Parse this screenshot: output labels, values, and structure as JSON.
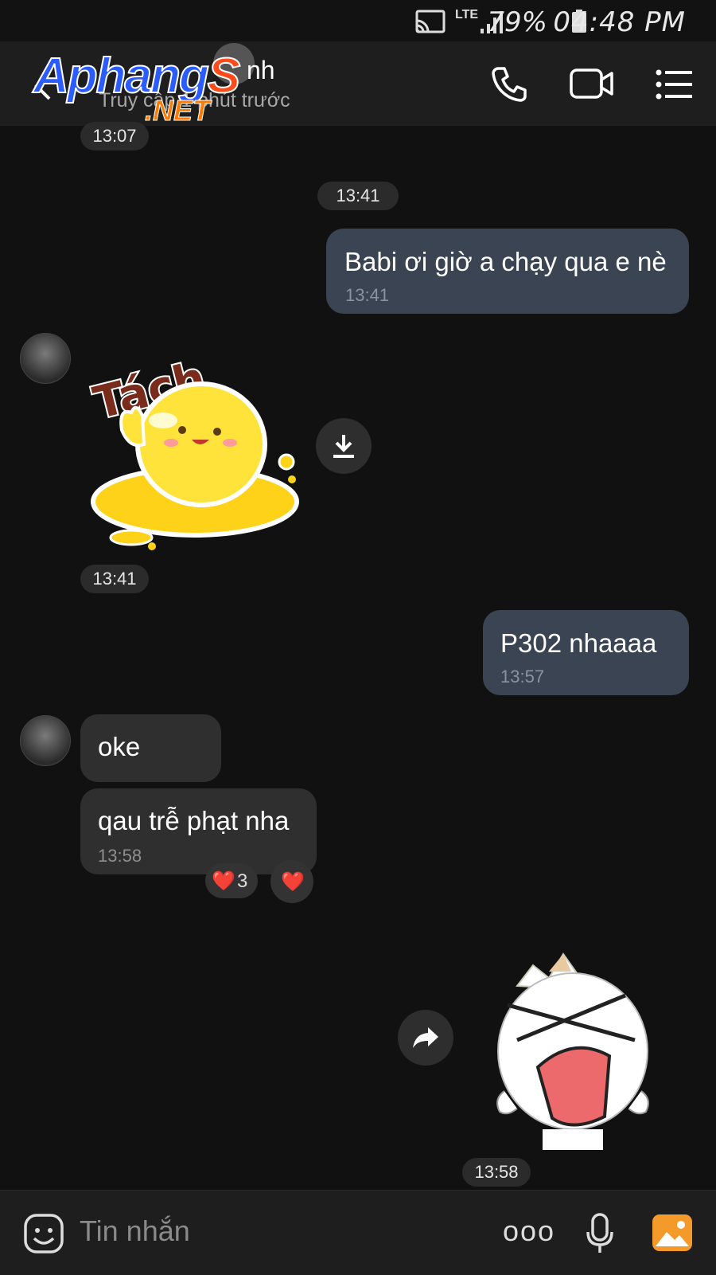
{
  "status_bar": {
    "network": "LTE",
    "battery": "79%",
    "time": "04:48 PM",
    "icons": [
      "cast-icon",
      "signal-icon",
      "battery-icon"
    ]
  },
  "header": {
    "contact_name": "nh",
    "status": "Truy cập 1 phút trước",
    "watermark_main": "Aphang",
    "watermark_s": "S",
    "watermark_net": ".NET",
    "icons": [
      "back-icon",
      "phone-icon",
      "video-icon",
      "menu-icon"
    ]
  },
  "messages": {
    "top_time": "13:07",
    "chip_1341": "13:41",
    "out_1": {
      "text": "Babi ơi giờ a chạy qua e nè",
      "time": "13:41"
    },
    "sticker_in": {
      "label": "Tách",
      "time": "13:41"
    },
    "out_2": {
      "text": "P302 nhaaaa",
      "time": "13:57"
    },
    "in_1": {
      "text": "oke"
    },
    "in_2": {
      "text": "qau trễ phạt nha",
      "time": "13:58"
    },
    "reaction": {
      "emoji": "❤️",
      "count": "3",
      "react_button": "❤️"
    },
    "sticker_out": {
      "time": "13:58"
    }
  },
  "composer": {
    "placeholder": "Tin nhắn",
    "more_label": "ooo",
    "icons": [
      "emoji-icon",
      "more-icon",
      "mic-icon",
      "gallery-icon"
    ]
  },
  "colors": {
    "background": "#111111",
    "outgoing_bubble": "#3a4452",
    "incoming_bubble": "#2f2f2f",
    "gallery_accent": "#f39a2a"
  }
}
